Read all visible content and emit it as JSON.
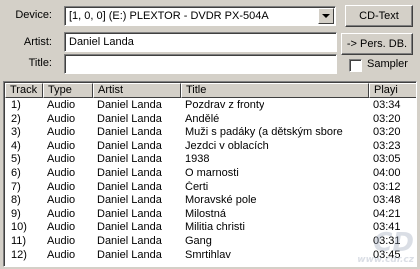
{
  "device": {
    "label": "Device:",
    "value": "[1, 0, 0] (E:)  PLEXTOR - DVDR   PX-504A"
  },
  "artist": {
    "label": "Artist:",
    "value": "Daniel Landa"
  },
  "title": {
    "label": "Title:",
    "value": ""
  },
  "buttons": {
    "cd_text": "CD-Text",
    "pers_db": "-> Pers. DB.",
    "sampler": "Sampler"
  },
  "columns": [
    "Track",
    "Type",
    "Artist",
    "Title",
    "Playi"
  ],
  "rows": [
    [
      "1)",
      "Audio",
      "Daniel Landa",
      "Pozdrav z fronty",
      "03:34"
    ],
    [
      "2)",
      "Audio",
      "Daniel Landa",
      "Andělé",
      "03:20"
    ],
    [
      "3)",
      "Audio",
      "Daniel Landa",
      "Muži s padáky (a dětským sbore",
      "03:20"
    ],
    [
      "4)",
      "Audio",
      "Daniel Landa",
      "Jezdci v oblacích",
      "03:23"
    ],
    [
      "5)",
      "Audio",
      "Daniel Landa",
      "1938",
      "03:05"
    ],
    [
      "6)",
      "Audio",
      "Daniel Landa",
      "O marnosti",
      "04:00"
    ],
    [
      "7)",
      "Audio",
      "Daniel Landa",
      "Čerti",
      "03:12"
    ],
    [
      "8)",
      "Audio",
      "Daniel Landa",
      "Moravské pole",
      "03:48"
    ],
    [
      "9)",
      "Audio",
      "Daniel Landa",
      "Milostná",
      "04:21"
    ],
    [
      "10)",
      "Audio",
      "Daniel Landa",
      "Militia christi",
      "03:41"
    ],
    [
      "11)",
      "Audio",
      "Daniel Landa",
      "Gang",
      "03:31"
    ],
    [
      "12)",
      "Audio",
      "Daniel Landa",
      "Smrtihlav",
      "03:45"
    ]
  ],
  "watermark": {
    "logo": "CD",
    "sub": "www.cdr.cz"
  }
}
